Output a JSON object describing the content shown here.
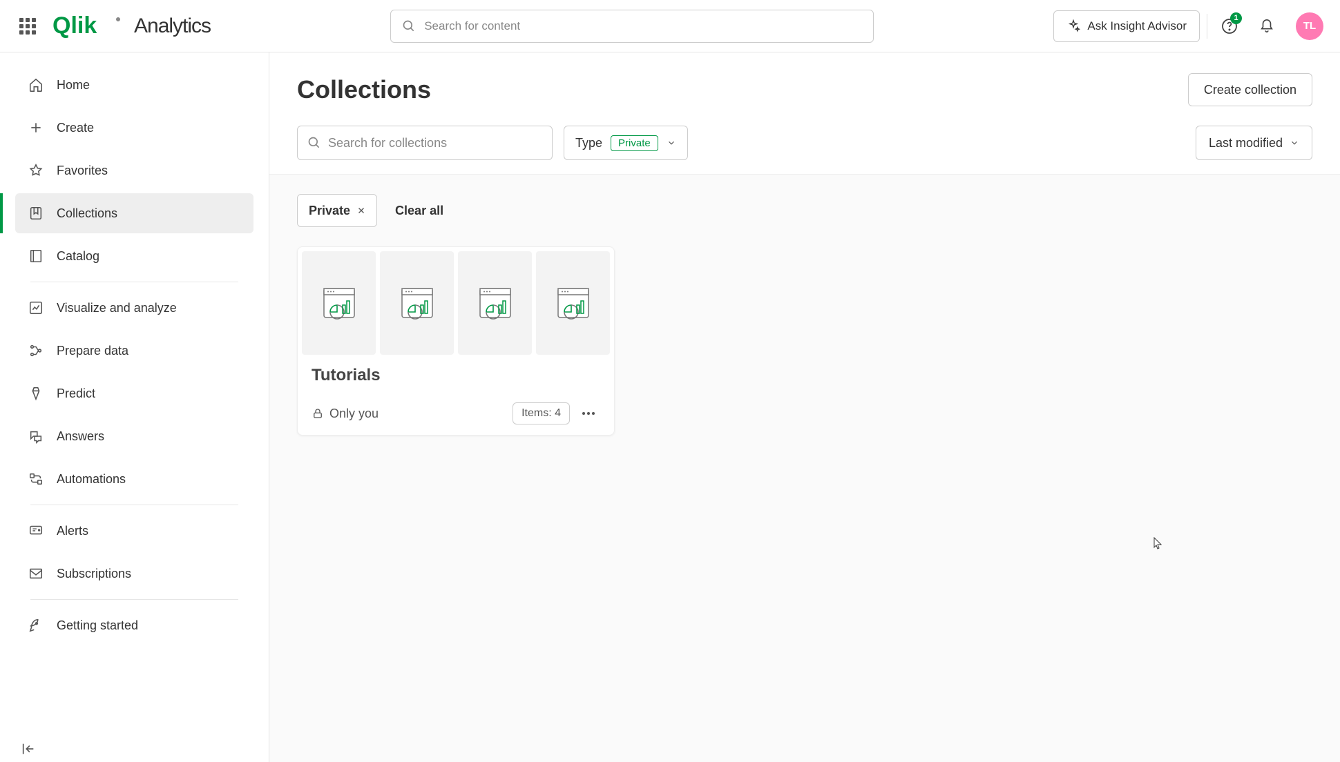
{
  "header": {
    "app_name": "Analytics",
    "search_placeholder": "Search for content",
    "insight_button": "Ask Insight Advisor",
    "notification_count": "1",
    "avatar_initials": "TL"
  },
  "sidebar": {
    "items": [
      {
        "label": "Home",
        "icon": "home-icon"
      },
      {
        "label": "Create",
        "icon": "plus-icon"
      },
      {
        "label": "Favorites",
        "icon": "star-icon"
      },
      {
        "label": "Collections",
        "icon": "collections-icon",
        "active": true
      },
      {
        "label": "Catalog",
        "icon": "catalog-icon"
      },
      {
        "label": "Visualize and analyze",
        "icon": "visualize-icon"
      },
      {
        "label": "Prepare data",
        "icon": "prepare-icon"
      },
      {
        "label": "Predict",
        "icon": "predict-icon"
      },
      {
        "label": "Answers",
        "icon": "answers-icon"
      },
      {
        "label": "Automations",
        "icon": "automations-icon"
      },
      {
        "label": "Alerts",
        "icon": "alerts-icon"
      },
      {
        "label": "Subscriptions",
        "icon": "subscriptions-icon"
      },
      {
        "label": "Getting started",
        "icon": "getting-started-icon"
      }
    ]
  },
  "page": {
    "title": "Collections",
    "create_button": "Create collection",
    "search_placeholder": "Search for collections",
    "type_filter_label": "Type",
    "type_filter_value": "Private",
    "sort_label": "Last modified",
    "chip_label": "Private",
    "clear_all": "Clear all"
  },
  "collections": [
    {
      "title": "Tutorials",
      "visibility": "Only you",
      "items_label": "Items: 4",
      "thumbnail_count": 4
    }
  ]
}
